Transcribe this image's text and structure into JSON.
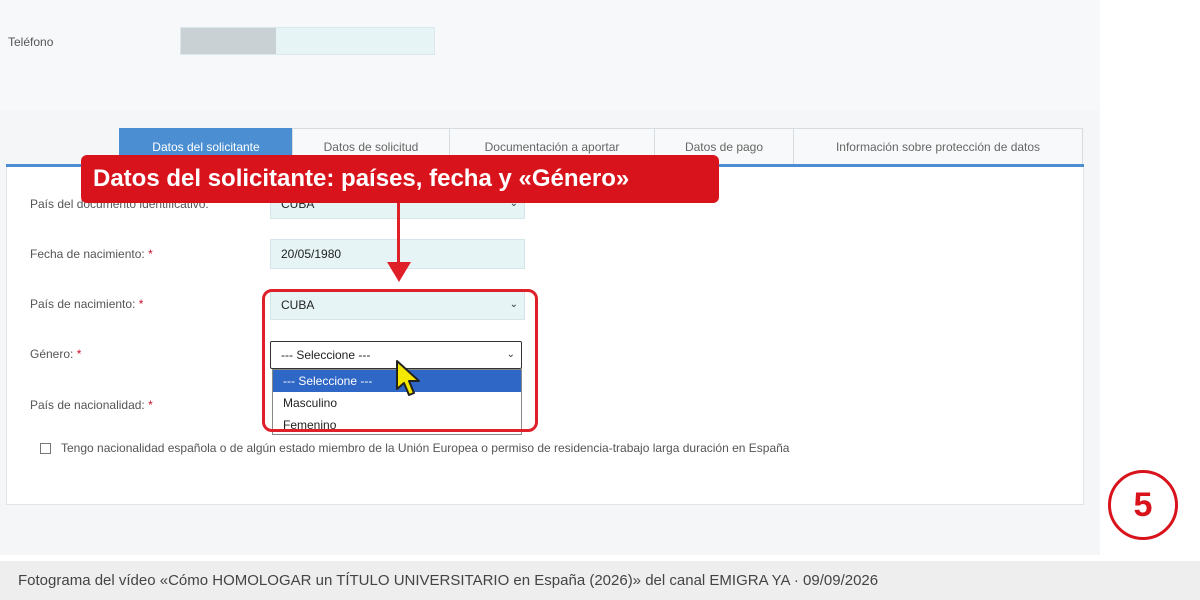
{
  "phone": {
    "label": "Teléfono"
  },
  "tabs": [
    {
      "label": "Datos del solicitante"
    },
    {
      "label": "Datos de solicitud"
    },
    {
      "label": "Documentación a aportar"
    },
    {
      "label": "Datos de pago"
    },
    {
      "label": "Información sobre protección de datos"
    }
  ],
  "form": {
    "doc_country": {
      "label": "País del documento identificativo:",
      "value": "CUBA"
    },
    "birth_date": {
      "label": "Fecha de nacimiento:",
      "required": "*",
      "value": "20/05/1980"
    },
    "birth_country": {
      "label": "País de nacimiento:",
      "required": "*",
      "value": "CUBA"
    },
    "gender": {
      "label": "Género:",
      "required": "*",
      "value": "--- Seleccione ---",
      "options": [
        "--- Seleccione ---",
        "Masculino",
        "Femenino"
      ]
    },
    "nationality": {
      "label": "País de nacionalidad:",
      "required": "*"
    },
    "eu_checkbox": {
      "label": "Tengo nacionalidad española o de algún estado miembro de la Unión Europea o permiso de residencia-trabajo larga duración en España"
    }
  },
  "annotation": {
    "callout": "Datos del solicitante: países, fecha y «Género»",
    "step": "5",
    "accent_color": "#d8131b"
  },
  "caption": "Fotograma del vídeo «Cómo HOMOLOGAR un TÍTULO UNIVERSITARIO en España (2026)» del canal EMIGRA YA · 09/09/2026"
}
